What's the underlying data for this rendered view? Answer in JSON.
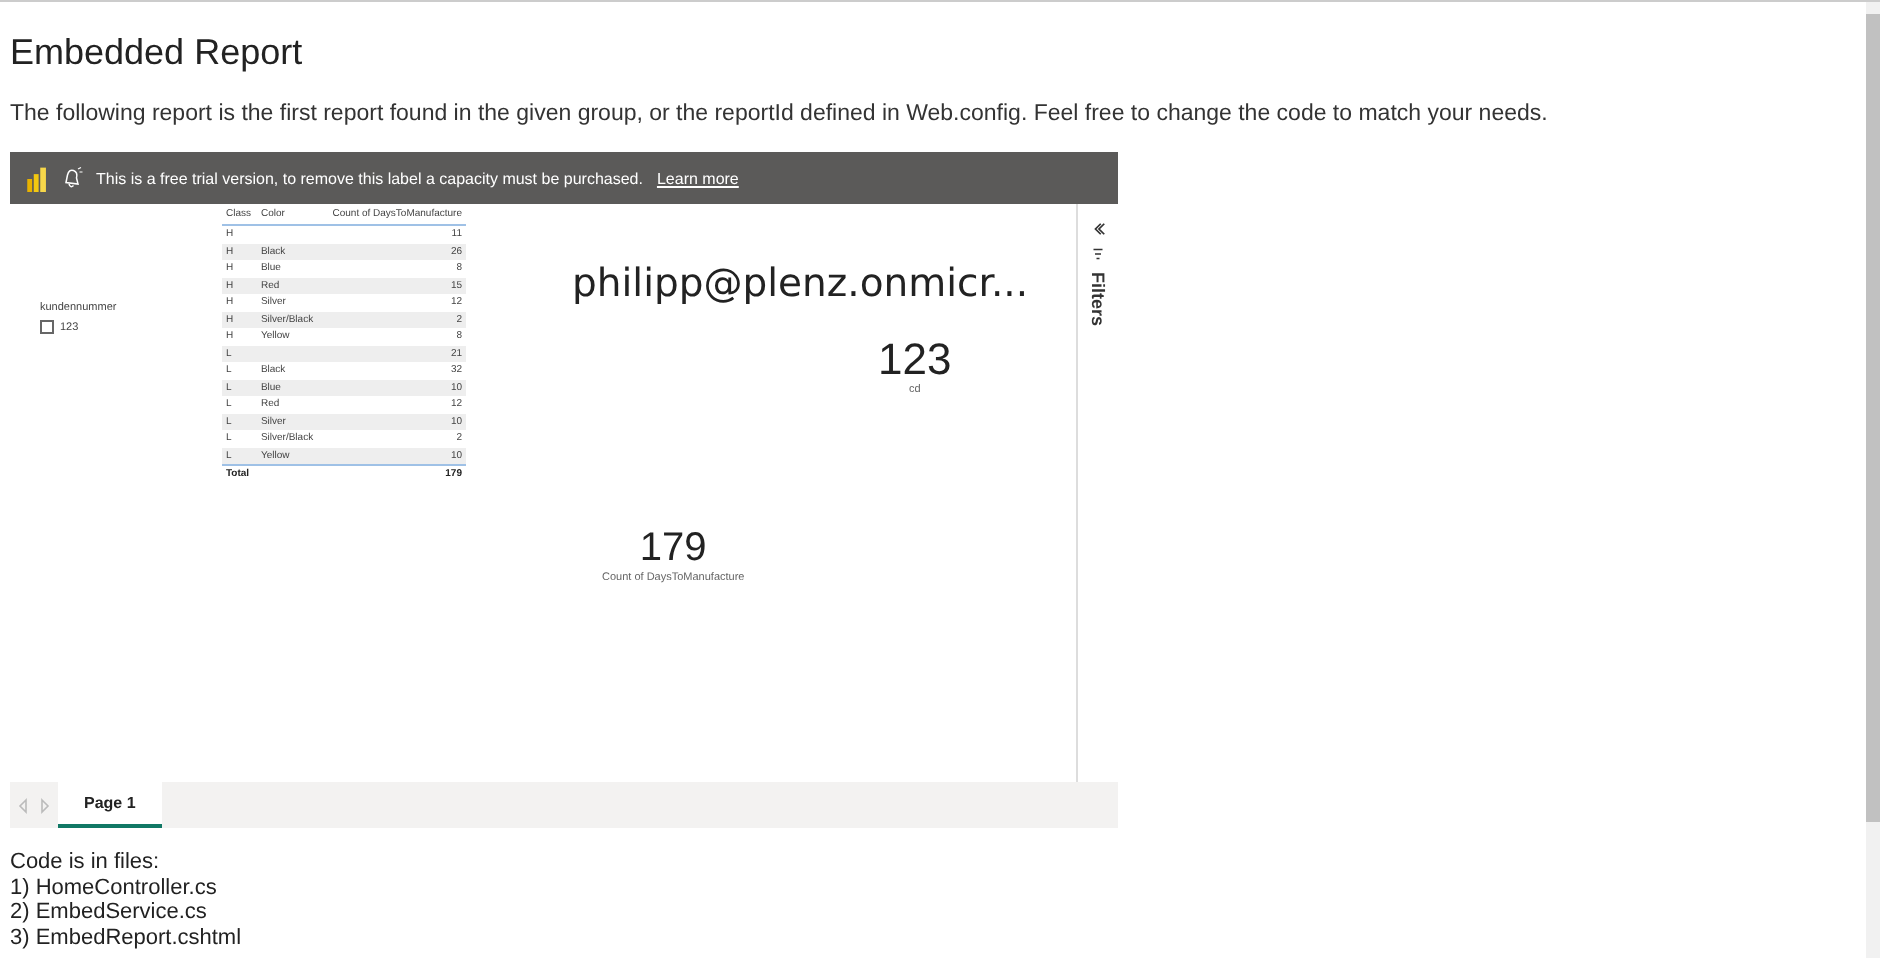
{
  "page": {
    "title": "Embedded Report",
    "intro": "The following report is the first report found in the given group, or the reportId defined in Web.config. Feel free to change the code to match your needs."
  },
  "report": {
    "banner": {
      "message": "This is a free trial version, to remove this label a capacity must be purchased.",
      "link": "Learn more"
    },
    "slicer": {
      "title": "kundennummer",
      "items": [
        {
          "label": "123",
          "checked": false
        }
      ]
    },
    "table": {
      "columns": [
        "Class",
        "Color",
        "Count of DaysToManufacture"
      ],
      "rows": [
        {
          "class": "H",
          "count": "11"
        },
        {
          "class": "H",
          "color_label": "Black",
          "count": "26"
        },
        {
          "class": "H",
          "color_label": "Blue",
          "count": "8"
        },
        {
          "class": "H",
          "color_label": "Red",
          "count": "15"
        },
        {
          "class": "H",
          "color_label": "Silver",
          "count": "12"
        },
        {
          "class": "H",
          "color_label": "Silver/Black",
          "count": "2"
        },
        {
          "class": "H",
          "color_label": "Yellow",
          "count": "8"
        },
        {
          "class": "L",
          "count": "21"
        },
        {
          "class": "L",
          "color_label": "Black",
          "count": "32"
        },
        {
          "class": "L",
          "color_label": "Blue",
          "count": "10"
        },
        {
          "class": "L",
          "color_label": "Red",
          "count": "12"
        },
        {
          "class": "L",
          "color_label": "Silver",
          "count": "10"
        },
        {
          "class": "L",
          "color_label": "Silver/Black",
          "count": "2"
        },
        {
          "class": "L",
          "color_label": "Yellow",
          "count": "10"
        }
      ],
      "total": {
        "label": "Total",
        "value": "179"
      }
    },
    "cards": [
      {
        "kind": "text",
        "value": "philipp@plenz.onmicr..."
      },
      {
        "kind": "number",
        "value": "123",
        "label": "cd"
      },
      {
        "kind": "count",
        "value": "179",
        "label": "Count of DaysToManufacture"
      }
    ],
    "filters": {
      "label": "Filters"
    },
    "pages": [
      {
        "label": "Page 1",
        "selected": true
      }
    ]
  },
  "footer": {
    "lines": [
      "Code is in files:",
      "1) HomeController.cs",
      "2) EmbedService.cs",
      "3) EmbedReport.cshtml"
    ]
  }
}
